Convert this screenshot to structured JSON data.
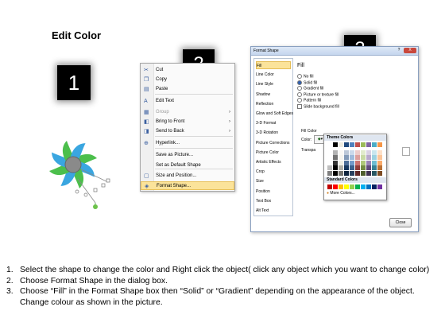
{
  "title": "Edit Color",
  "badges": [
    "1",
    "2",
    "3"
  ],
  "context_menu": {
    "items": [
      {
        "label": "Cut",
        "icon": "scissors-icon",
        "glyph": "✂",
        "disabled": false
      },
      {
        "label": "Copy",
        "icon": "copy-icon",
        "glyph": "❐",
        "disabled": false
      },
      {
        "label": "Paste",
        "icon": "paste-icon",
        "glyph": "▤",
        "disabled": false
      },
      {
        "label": "Edit Text",
        "icon": "edit-text-icon",
        "glyph": "A",
        "disabled": false
      },
      {
        "label": "Group",
        "icon": "group-icon",
        "glyph": "▦",
        "disabled": true,
        "submenu": true
      },
      {
        "label": "Bring to Front",
        "icon": "bring-front-icon",
        "glyph": "◧",
        "disabled": false,
        "submenu": true
      },
      {
        "label": "Send to Back",
        "icon": "send-back-icon",
        "glyph": "◨",
        "disabled": false,
        "submenu": true
      },
      {
        "label": "Hyperlink...",
        "icon": "hyperlink-icon",
        "glyph": "⊕",
        "disabled": false
      },
      {
        "label": "Save as Picture...",
        "icon": "",
        "glyph": "",
        "disabled": false
      },
      {
        "label": "Set as Default Shape",
        "icon": "",
        "glyph": "",
        "disabled": false
      },
      {
        "label": "Size and Position...",
        "icon": "size-position-icon",
        "glyph": "▢",
        "disabled": false
      },
      {
        "label": "Format Shape...",
        "icon": "format-shape-icon",
        "glyph": "◈",
        "disabled": false,
        "highlighted": true
      }
    ]
  },
  "dialog": {
    "title": "Format Shape",
    "help": "?",
    "close_x": "X",
    "categories": [
      "Fill",
      "Line Color",
      "Line Style",
      "Shadow",
      "Reflection",
      "Glow and Soft Edges",
      "3-D Format",
      "3-D Rotation",
      "Picture Corrections",
      "Picture Color",
      "Artistic Effects",
      "Crop",
      "Size",
      "Position",
      "Text Box",
      "Alt Text"
    ],
    "selected_category": "Fill",
    "pane_header": "Fill",
    "options": [
      {
        "label": "No fill",
        "kind": "radio",
        "on": false
      },
      {
        "label": "Solid fill",
        "kind": "radio",
        "on": true
      },
      {
        "label": "Gradient fill",
        "kind": "radio",
        "on": false
      },
      {
        "label": "Picture or texture fill",
        "kind": "radio",
        "on": false
      },
      {
        "label": "Pattern fill",
        "kind": "radio",
        "on": false
      },
      {
        "label": "Slide background fill",
        "kind": "check",
        "on": false
      }
    ],
    "fill_color_label": "Fill Color",
    "color_label": "Color:",
    "transparency_label": "Transpa",
    "close_button": "Close"
  },
  "palette": {
    "theme_header": "Theme Colors",
    "standard_header": "Standard Colors",
    "more_colors": "More Colors...",
    "theme_top": [
      "#ffffff",
      "#000000",
      "#eeece1",
      "#1f497d",
      "#4f81bd",
      "#c0504d",
      "#9bbb59",
      "#8064a2",
      "#4bacc6",
      "#f79646"
    ],
    "standard": [
      "#c00000",
      "#ff0000",
      "#ffc000",
      "#ffff00",
      "#92d050",
      "#00b050",
      "#00b0f0",
      "#0070c0",
      "#002060",
      "#7030a0"
    ]
  },
  "instructions": [
    {
      "num": "1.",
      "text": "Select the shape to change the color and Right click the object( click any object which you want to change color)"
    },
    {
      "num": "2.",
      "text": "Choose Format Shape in the dialog box."
    },
    {
      "num": "3.",
      "text": "Choose “Fill” in the Format Shape box then “Solid” or “Gradient” depending on the appearance of the object. Change colour as shown in the picture."
    }
  ]
}
